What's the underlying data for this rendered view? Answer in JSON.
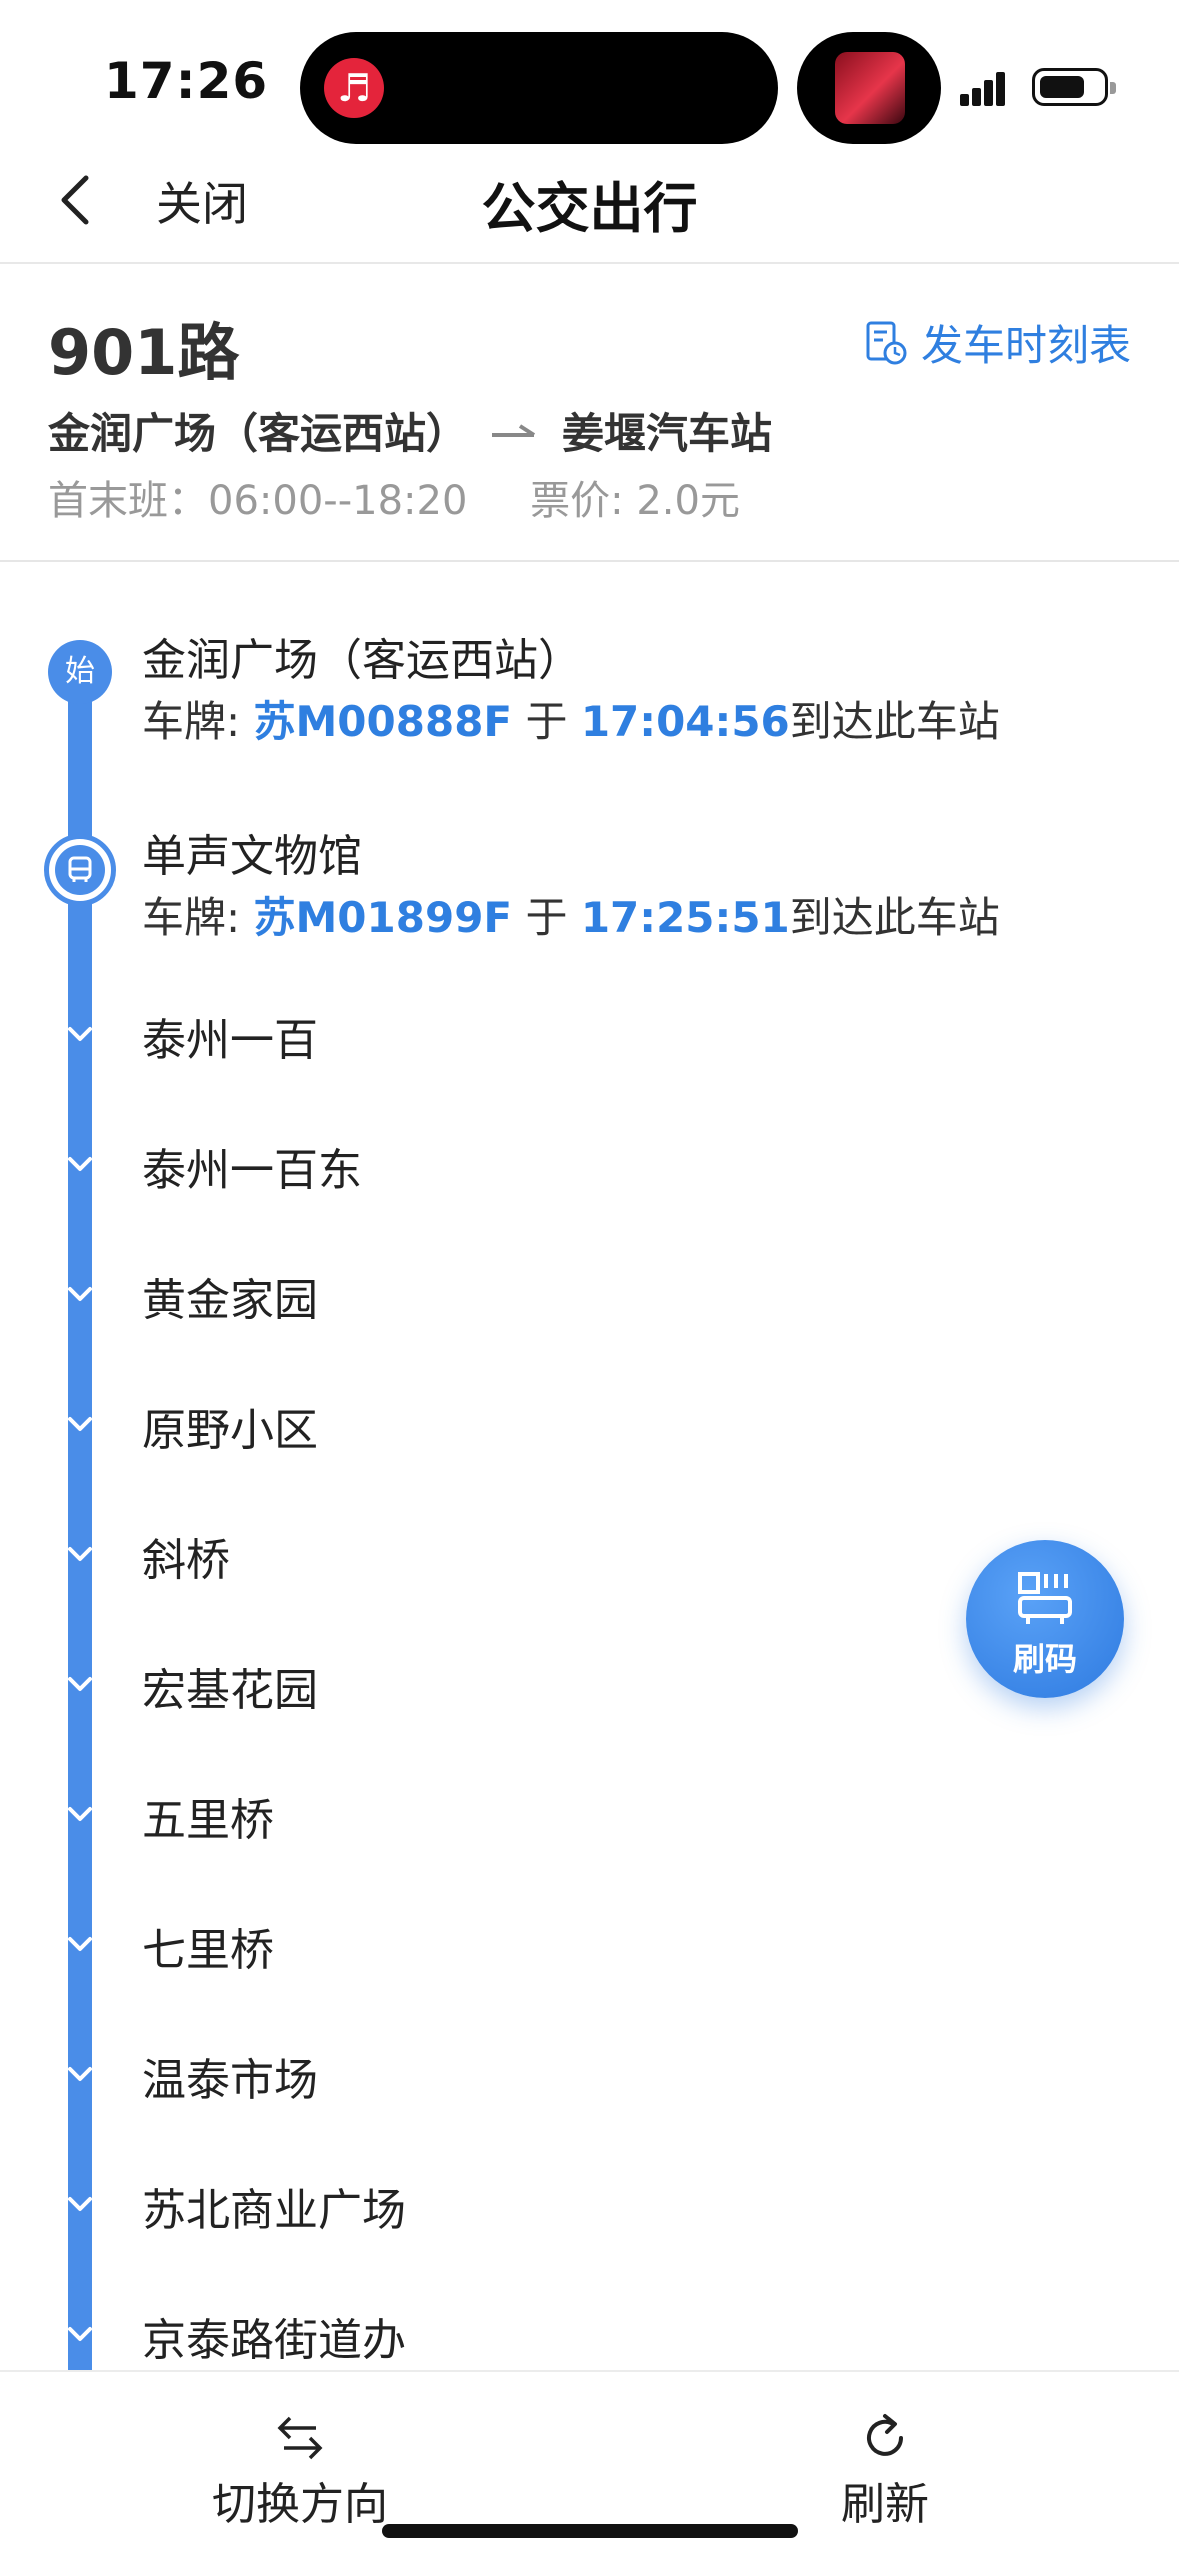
{
  "status_bar": {
    "time": "17:26"
  },
  "nav": {
    "close_label": "关闭",
    "title": "公交出行"
  },
  "route": {
    "name": "901路",
    "timetable_label": "发车时刻表",
    "from": "金润广场（客运西站）",
    "to": "姜堰汽车站",
    "hours_label": "首末班：06:00--18:20",
    "fare_label": "票价: 2.0元"
  },
  "start_badge": "始",
  "buses": [
    {
      "stop": "金润广场（客运西站）",
      "prefix": "车牌: ",
      "plate": "苏M00888F",
      "mid": " 于 ",
      "time": "17:04:56",
      "suffix": "到达此车站"
    },
    {
      "stop": "单声文物馆",
      "prefix": "车牌: ",
      "plate": "苏M01899F",
      "mid": " 于 ",
      "time": "17:25:51",
      "suffix": "到达此车站"
    }
  ],
  "stops": [
    "泰州一百",
    "泰州一百东",
    "黄金家园",
    "原野小区",
    "斜桥",
    "宏基花园",
    "五里桥",
    "七里桥",
    "温泰市场",
    "苏北商业广场",
    "京泰路街道办"
  ],
  "floating_button": {
    "label": "刷码"
  },
  "bottom_bar": {
    "switch_label": "切换方向",
    "refresh_label": "刷新"
  },
  "colors": {
    "accent": "#2f7fe0",
    "line": "#4a8de8"
  }
}
